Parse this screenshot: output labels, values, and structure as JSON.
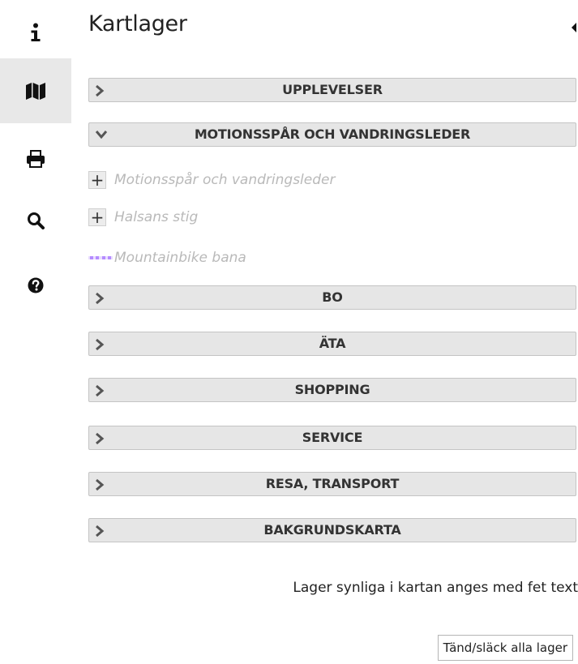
{
  "rail": {
    "items": [
      {
        "icon": "info-icon",
        "active": false
      },
      {
        "icon": "map-icon",
        "active": true
      },
      {
        "icon": "print-icon",
        "active": false
      },
      {
        "icon": "search-icon",
        "active": false
      },
      {
        "icon": "help-icon",
        "active": false
      }
    ]
  },
  "panel": {
    "title": "Kartlager",
    "groups": [
      {
        "label": "UPPLEVELSER",
        "expanded": false
      },
      {
        "label": "MOTIONSSPÅR OCH VANDRINGSLEDER",
        "expanded": true
      },
      {
        "label": "BO",
        "expanded": false
      },
      {
        "label": "ÄTA",
        "expanded": false
      },
      {
        "label": "SHOPPING",
        "expanded": false
      },
      {
        "label": "SERVICE",
        "expanded": false
      },
      {
        "label": "RESA, TRANSPORT",
        "expanded": false
      },
      {
        "label": "BAKGRUNDSKARTA",
        "expanded": false
      }
    ],
    "layers": [
      {
        "label": "Motionsspår och vandringsleder",
        "control": "plus"
      },
      {
        "label": "Halsans stig",
        "control": "plus"
      },
      {
        "label": "Mountainbike bana",
        "control": "legend",
        "legend_color": "#b58cff"
      }
    ],
    "plus_symbol": "+",
    "info_text": "Lager synliga i kartan anges med fet text",
    "toggle_all_label": "Tänd/släck alla lager"
  },
  "colors": {
    "header_bg": "#e6e6e6",
    "header_border": "#c4c4c4",
    "active_rail_bg": "#e8e8e8",
    "muted_text": "#b9b9b9"
  }
}
